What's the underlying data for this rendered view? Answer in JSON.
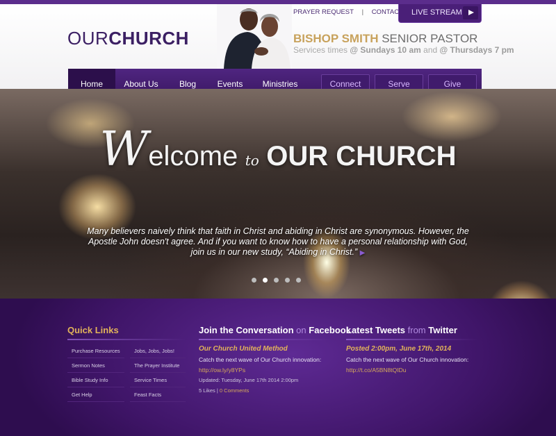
{
  "brand": {
    "logo_thin": "OUR",
    "logo_bold": "CHURCH"
  },
  "top_links": {
    "prayer_request": "PRAYER REQUEST",
    "separator": "|",
    "contact_us": "CONTACT US"
  },
  "livestream": {
    "label": "LIVE STREAM",
    "icon": "play-icon"
  },
  "pastor": {
    "name": "BISHOP SMITH",
    "title": "SENIOR PASTOR"
  },
  "services": {
    "prefix": "Services times",
    "sunday": "@ Sundays 10 am",
    "and": "and",
    "thursday": "@ Thursdays 7 pm"
  },
  "nav": {
    "items": [
      "Home",
      "About Us",
      "Blog",
      "Events",
      "Ministries"
    ],
    "buttons": [
      "Connect",
      "Serve",
      "Give"
    ],
    "active": "Home"
  },
  "hero": {
    "title_w": "W",
    "title_elcome": "elcome",
    "title_to": "to",
    "title_rest": "OUR CHURCH",
    "caption": "Many believers naively think that faith in Christ and abiding in Christ are synonymous. However, the Apostle John doesn't agree. And if you want to know how to have a personal relationship with God, join us in our new study, “Abiding in Christ.”",
    "caption_arrow": "▶",
    "slides": 5,
    "active_slide": 2
  },
  "footer": {
    "quick_links": {
      "title": "Quick Links",
      "items": [
        "Purchase Resources",
        "Jobs, Jobs, Jobs!",
        "Sermon Notes",
        "The Prayer Institute",
        "Bible Study Info",
        "Service Times",
        "Get Help",
        "Feast Facts"
      ]
    },
    "facebook": {
      "title_a": "Join the Conversation",
      "title_on": "on",
      "title_b": "Facebook",
      "post_author": "Our Church United Method",
      "post_text": "Catch the next wave of Our Church innovation:",
      "post_link": "http://ow.ly/y8YPs",
      "updated": "Updated: Tuesday, June 17th 2014 2:00pm",
      "likes": "5 Likes",
      "sep": "|",
      "comments": "0 Comments"
    },
    "twitter": {
      "title_a": "Latest Tweets",
      "title_from": "from",
      "title_b": "Twitter",
      "posted": "Posted 2:00pm, June 17th, 2014",
      "post_text": "Catch the next wave of Our Church innovation:",
      "post_link": "http://t.co/A5BN8tQIDu"
    }
  },
  "colors": {
    "brand_purple": "#4a1f78",
    "gold": "#c8a25c",
    "footer_bg": "#3f1568"
  }
}
